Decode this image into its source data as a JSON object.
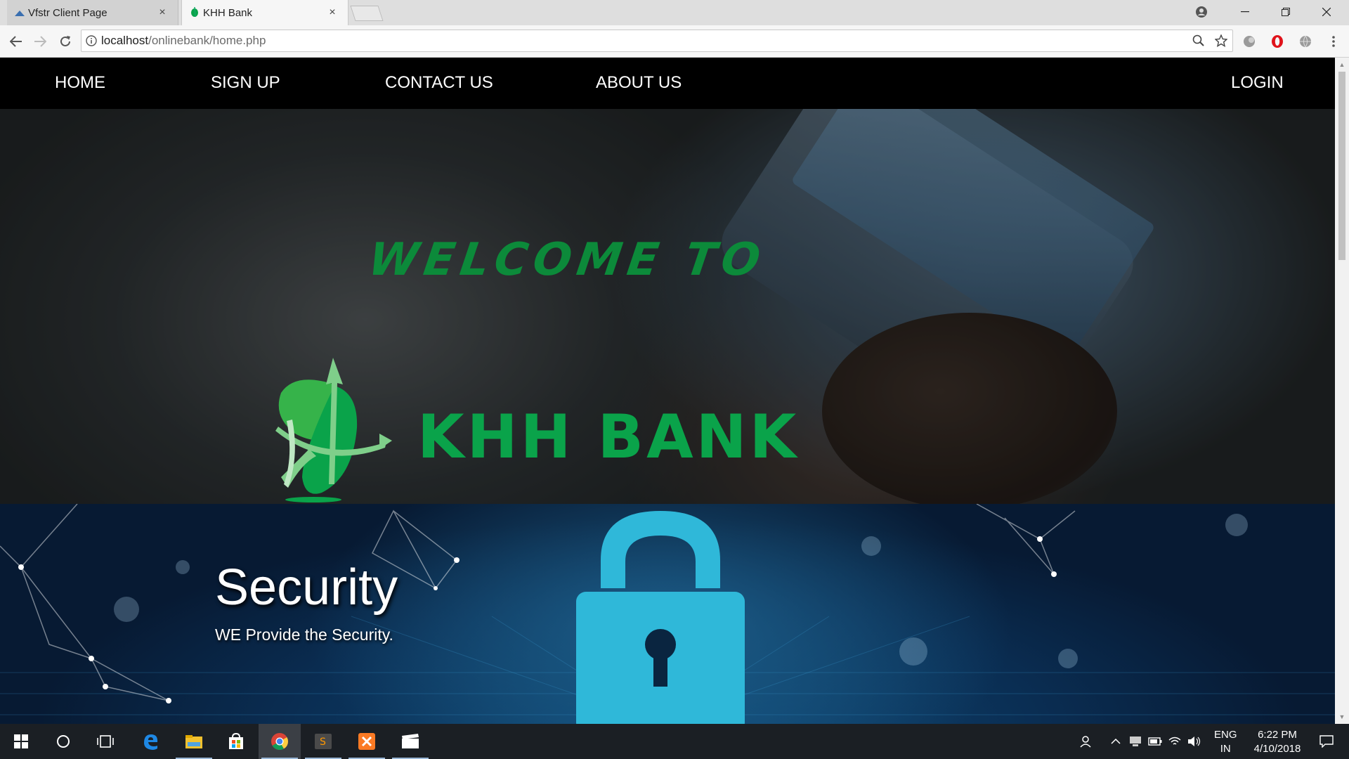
{
  "browser": {
    "tabs": [
      {
        "title": "Vfstr Client Page",
        "active": false,
        "favicon": "triangle-favicon-icon"
      },
      {
        "title": "KHH Bank",
        "active": true,
        "favicon": "khh-favicon-icon"
      }
    ],
    "address": {
      "host": "localhost",
      "path": "/onlinebank/home.php"
    }
  },
  "site": {
    "nav": {
      "home": "HOME",
      "signup": "SIGN UP",
      "contact": "CONTACT US",
      "about": "ABOUT US",
      "login": "LOGIN"
    },
    "hero": {
      "welcome": "WELCOME TO",
      "bank_name": "KHH BANK"
    },
    "security": {
      "title": "Security",
      "subtitle": "WE Provide the Security."
    },
    "colors": {
      "brand_green": "#0aa34a",
      "nav_bg": "#000000",
      "lock_cyan": "#2fb8d9"
    }
  },
  "taskbar": {
    "apps": [
      "start-icon",
      "cortana-icon",
      "task-view-icon",
      "edge-icon",
      "file-explorer-icon",
      "store-icon",
      "chrome-icon",
      "sublime-icon",
      "xampp-icon",
      "video-editor-icon"
    ],
    "language": {
      "line1": "ENG",
      "line2": "IN"
    },
    "time": "6:22 PM",
    "date": "4/10/2018"
  }
}
